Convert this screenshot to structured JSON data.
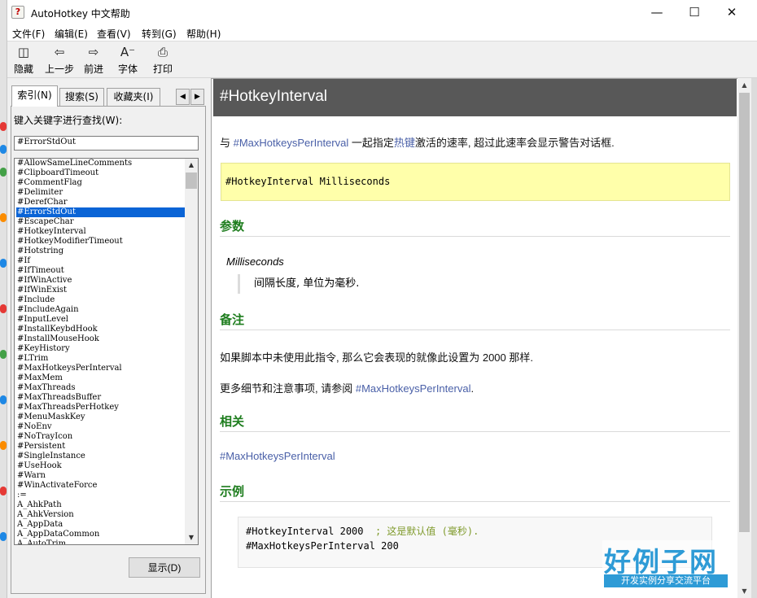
{
  "window": {
    "title": "AutoHotkey 中文帮助",
    "icon": "ahk-help-icon",
    "controls": [
      "minimize-icon",
      "maximize-icon",
      "close-icon"
    ]
  },
  "menu": {
    "file": "文件(F)",
    "edit": "编辑(E)",
    "view": "查看(V)",
    "goto": "转到(G)",
    "help": "帮助(H)"
  },
  "toolbar": {
    "hide": "隐藏",
    "back": "上一步",
    "forward": "前进",
    "font": "字体",
    "print": "打印"
  },
  "nav": {
    "tabs": {
      "index": "索引(N)",
      "search": "搜索(S)",
      "favorites": "收藏夹(I)"
    },
    "keyword_label": "键入关键字进行查找(W):",
    "keyword_value": "#ErrorStdOut",
    "selected_index": 5,
    "display_button": "显示(D)",
    "keywords": [
      "#AllowSameLineComments",
      "#ClipboardTimeout",
      "#CommentFlag",
      "#Delimiter",
      "#DerefChar",
      "#ErrorStdOut",
      "#EscapeChar",
      "#HotkeyInterval",
      "#HotkeyModifierTimeout",
      "#Hotstring",
      "#If",
      "#IfTimeout",
      "#IfWinActive",
      "#IfWinExist",
      "#Include",
      "#IncludeAgain",
      "#InputLevel",
      "#InstallKeybdHook",
      "#InstallMouseHook",
      "#KeyHistory",
      "#LTrim",
      "#MaxHotkeysPerInterval",
      "#MaxMem",
      "#MaxThreads",
      "#MaxThreadsBuffer",
      "#MaxThreadsPerHotkey",
      "#MenuMaskKey",
      "#NoEnv",
      "#NoTrayIcon",
      "#Persistent",
      "#SingleInstance",
      "#UseHook",
      "#Warn",
      "#WinActivateForce",
      ":=",
      "A_AhkPath",
      "A_AhkVersion",
      "A_AppData",
      "A_AppDataCommon",
      "A_AutoTrim"
    ]
  },
  "doc": {
    "title": "#HotkeyInterval",
    "intro": {
      "pre": "与 ",
      "link1": "#MaxHotkeysPerInterval",
      "mid": " 一起指定",
      "link2": "热键",
      "post": "激活的速率, 超过此速率会显示警告对话框."
    },
    "syntax": "#HotkeyInterval Milliseconds",
    "params_heading": "参数",
    "param_name": "Milliseconds",
    "param_desc": "间隔长度, 单位为毫秒.",
    "remarks_heading": "备注",
    "remark1": "如果脚本中未使用此指令, 那么它会表现的就像此设置为 2000 那样.",
    "remark2_pre": "更多细节和注意事项, 请参阅 ",
    "remark2_link": "#MaxHotkeysPerInterval",
    "remark2_post": ".",
    "related_heading": "相关",
    "related_link": "#MaxHotkeysPerInterval",
    "example_heading": "示例",
    "example_line1_code": "#HotkeyInterval 2000",
    "example_line1_comment": "; 这是默认值 (毫秒).",
    "example_line2": "#MaxHotkeysPerInterval 200"
  },
  "watermark": {
    "brand": "好例子网",
    "tagline": "开发实例分享交流平台"
  },
  "colors": {
    "header_bg": "#585858",
    "heading_green": "#1e7d1e",
    "link_blue": "#4a60a8",
    "syntax_bg": "#ffffaa",
    "selection_blue": "#0a64d6",
    "comment_green": "#7f9a2b"
  }
}
